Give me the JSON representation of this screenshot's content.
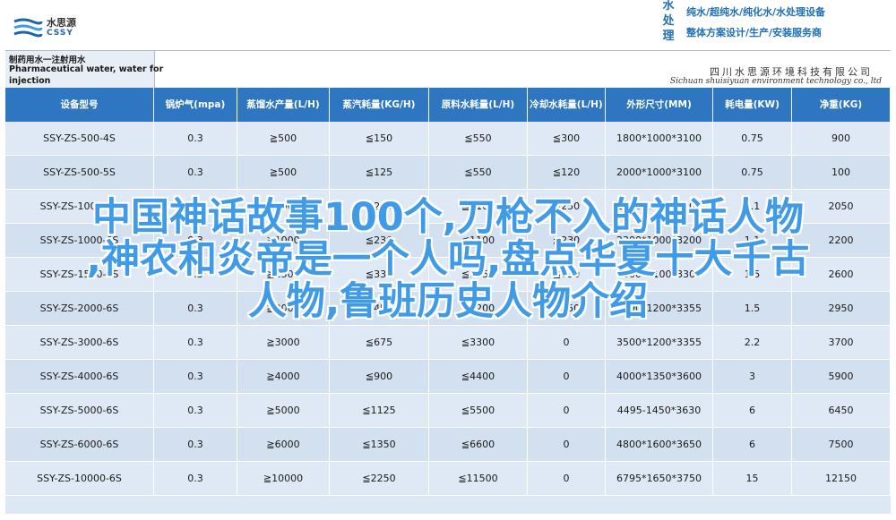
{
  "brand": {
    "name_cn": "水思源",
    "name_en": "CSSY",
    "color": "#1d63b0"
  },
  "slogan": {
    "vertical": [
      "水",
      "处",
      "理"
    ],
    "line1": "纯水/超纯水/纯化水/水处理设备",
    "line2": "整体方案设计/生产/安装服务商"
  },
  "product": {
    "title_line1": "制药用水一注射用水",
    "title_line2": "Pharmaceutical water, water for",
    "title_line3": "injection",
    "company_cn": "四川水思源环境科技有限公司",
    "company_en": "Sichuan shuisiyuan environment technology co., ltd"
  },
  "table": {
    "columns": [
      "设备型号",
      "锅炉气(mpa)",
      "蒸馏水产量(L/H)",
      "蒸汽耗量(KG/H)",
      "原料水耗量(L/H)",
      "冷却水耗量(L/H)",
      "外形尺寸(MM)",
      "耗电量(KW)",
      "净重(KG)"
    ],
    "rows": [
      [
        "SSY-ZS-500-4S",
        "0.3",
        "≧500",
        "≦150",
        "≦550",
        "≦300",
        "1800*1000*3100",
        "0.75",
        "900"
      ],
      [
        "SSY-ZS-500-5S",
        "0.3",
        "≧500",
        "≦125",
        "≦550",
        "≦120",
        "2000*1000*3100",
        "0.75",
        "100"
      ],
      [
        "SSY-ZS-1000-5S",
        "0.3",
        "≧1000",
        "≦250",
        "≦1100",
        "≦250",
        "2200*1000*3100",
        "1.1",
        "2050"
      ],
      [
        "SSY-ZS-1000-6S",
        "0.3",
        "≧1000",
        "≦230",
        "≦1100",
        "≦230",
        "2300*1000*3200",
        "1.1",
        "2200"
      ],
      [
        "SSY-ZS-1500-6S",
        "0.3",
        "≧1500",
        "≦330",
        "≦1650",
        "≦330",
        "2600*1100*3300",
        "1.5",
        "2600"
      ],
      [
        "SSY-ZS-2000-6S",
        "0.3",
        "≧2000",
        "≦450",
        "≦2200",
        "≦450",
        "2800*1200*3355",
        "1.5",
        "2950"
      ],
      [
        "SSY-ZS-3000-6S",
        "0.3",
        "≧3000",
        "≦675",
        "≦3300",
        "0",
        "3500*1200*3355",
        "2.2",
        "3700"
      ],
      [
        "SSY-ZS-4000-6S",
        "0.3",
        "≧4000",
        "≦900",
        "≦4400",
        "0",
        "4000*1350*3600",
        "3",
        "5900"
      ],
      [
        "SSY-ZS-5000-6S",
        "0.3",
        "≧5000",
        "≦1125",
        "≦5500",
        "0",
        "4495-1450*3630",
        "6",
        "6450"
      ],
      [
        "SSY-ZS-6000-6S",
        "0.3",
        "≧6000",
        "≦1350",
        "≦6600",
        "0",
        "4800*1600*3650",
        "6",
        "7500"
      ],
      [
        "SSY-ZS-10000-6S",
        "0.3",
        "≧10000",
        "≦2250",
        "≦11500",
        "0",
        "6795*1650*3750",
        "15",
        "12150"
      ]
    ],
    "header_color": "#2e76c0"
  },
  "overlay": {
    "line1": "中国神话故事100个,刀枪不入的神话人物",
    "line2": ",神农和炎帝是一个人吗,盘点华夏十大千古",
    "line3": "人物,鲁班历史人物介绍",
    "color": "#3f9be8"
  }
}
